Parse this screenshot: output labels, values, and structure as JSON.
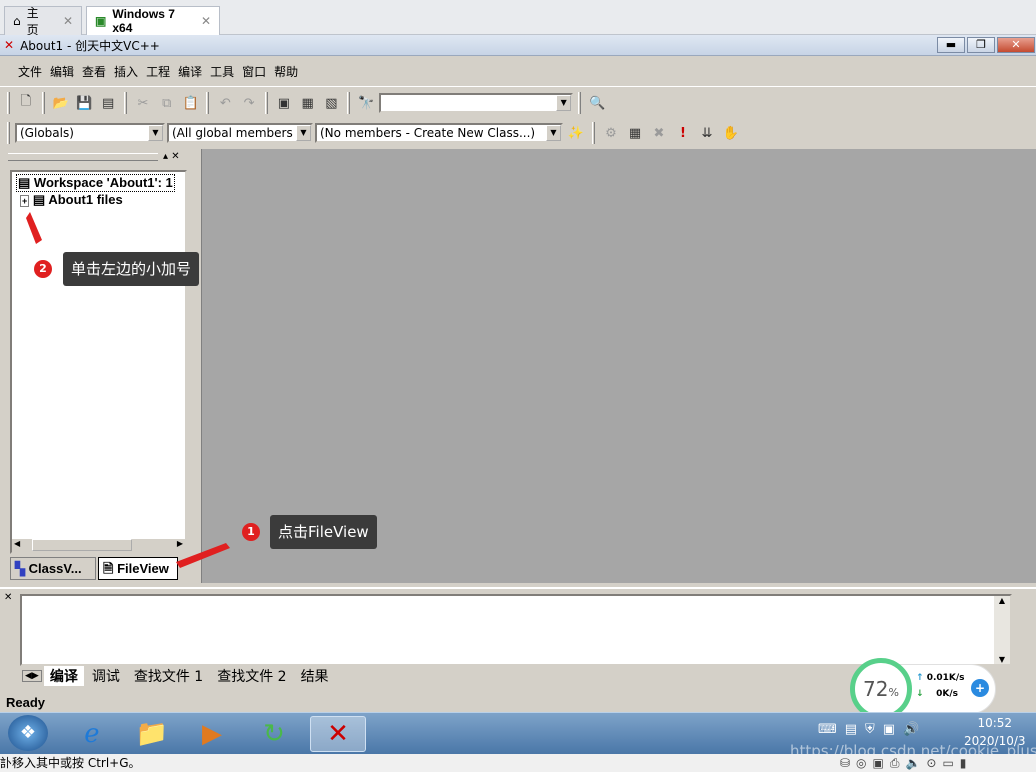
{
  "browser_tabs": [
    {
      "label": "主页"
    },
    {
      "label": "Windows 7 x64"
    }
  ],
  "window": {
    "title": "About1 - 创天中文VC++"
  },
  "menu": [
    "文件",
    "编辑",
    "查看",
    "插入",
    "工程",
    "编译",
    "工具",
    "窗口",
    "帮助"
  ],
  "find_combo": {
    "value": ""
  },
  "wizard_bar": {
    "class_combo": "(Globals)",
    "filter_combo": "(All global members",
    "members_combo": "(No members - Create New Class...)"
  },
  "workspace": {
    "root": "Workspace 'About1': 1",
    "child": "About1 files",
    "tabs": [
      "ClassV...",
      "FileView"
    ]
  },
  "annotations": [
    {
      "num": "2",
      "text": "单击左边的小加号"
    },
    {
      "num": "1",
      "text": "点击FileView"
    }
  ],
  "output_tabs": [
    "编译",
    "调试",
    "查找文件 1",
    "查找文件 2",
    "结果"
  ],
  "status": "Ready",
  "net_widget": {
    "percent": "72",
    "unit": "%",
    "up": "0.01K/s",
    "down": "0K/s"
  },
  "clock": {
    "time": "10:52",
    "date": "2020/10/3"
  },
  "watermark": "https://blog.csdn.net/cookie_plus",
  "bottom_hint": "訃移入其中或按 Ctrl+G。"
}
